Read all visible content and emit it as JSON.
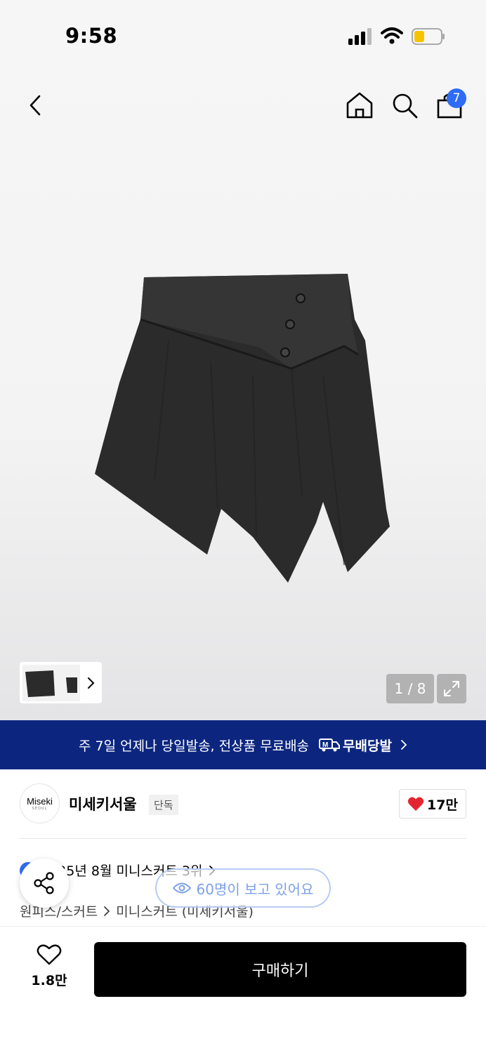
{
  "status_bar": {
    "time": "9:58"
  },
  "nav": {
    "cart_count": "7"
  },
  "gallery": {
    "page_indicator": "1 / 8"
  },
  "delivery_banner": {
    "text": "주 7일 언제나 당일발송, 전상품 무료배송",
    "logo_text": "무배당발"
  },
  "brand": {
    "logo_text": "Miseki",
    "logo_subtext": "SEOUL",
    "name": "미세키서울",
    "badge": "단독",
    "like_count": "17만"
  },
  "ranking": {
    "text": "2025년 8월 미니스커트 3위"
  },
  "category": {
    "path": [
      "원피스/스커트",
      "미니스커트 (미세키서울)"
    ]
  },
  "viewers": {
    "text": "60명이 보고 있어요"
  },
  "bottom": {
    "wish_count": "1.8만",
    "buy_label": "구매하기"
  },
  "colors": {
    "banner_bg": "#0c2680",
    "badge_blue": "#2e6cf6",
    "heart_red": "#e3262f",
    "buy_bg": "#000000"
  },
  "icons": [
    "back-icon",
    "home-icon",
    "search-icon",
    "cart-icon",
    "chevron-right-icon",
    "expand-icon",
    "truck-icon",
    "heart-icon",
    "share-icon",
    "eye-icon"
  ]
}
